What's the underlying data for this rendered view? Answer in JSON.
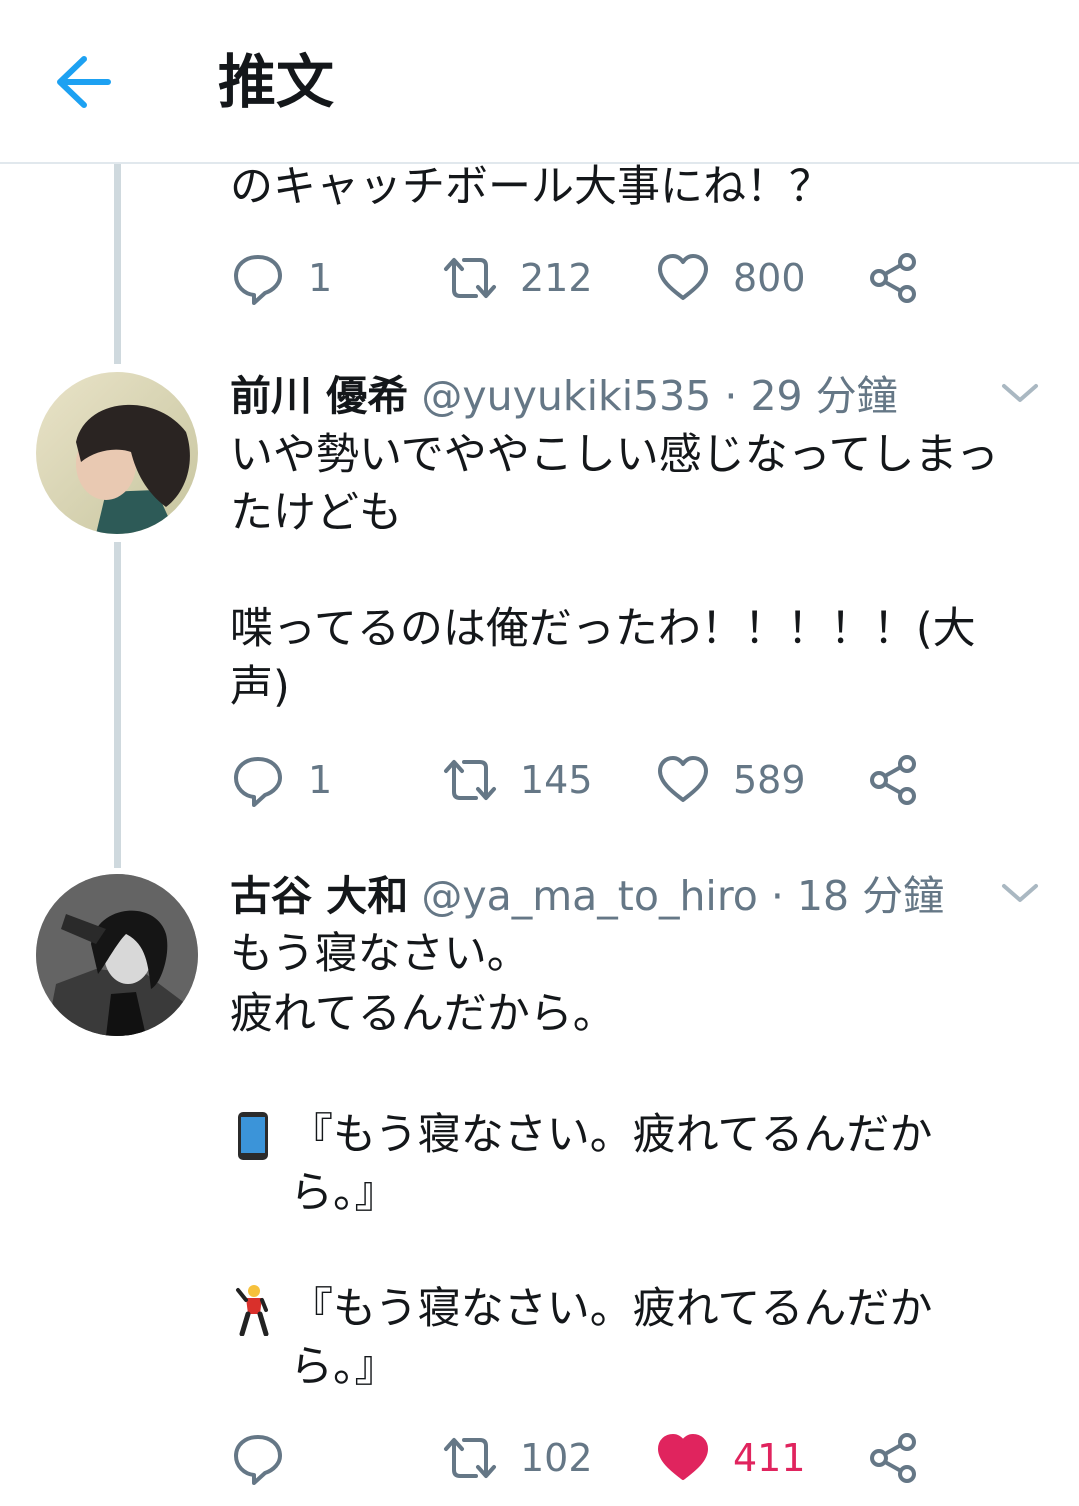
{
  "header": {
    "title": "推文"
  },
  "colors": {
    "accent": "#1da1f2",
    "like_active": "#e0245e",
    "muted": "#657786"
  },
  "tweets": [
    {
      "text": "のキャッチボール大事にね！？",
      "reply_count": "1",
      "retweet_count": "212",
      "like_count": "800",
      "liked": false
    },
    {
      "name": "前川 優希",
      "handle": "@yuyukiki535",
      "time": "· 29 分鐘",
      "text": "いや勢いでややこしい感じなってしまったけども\n\n喋ってるのは俺だったわ！！！！！(大声)",
      "reply_count": "1",
      "retweet_count": "145",
      "like_count": "589",
      "liked": false
    },
    {
      "name": "古谷 大和",
      "handle": "@ya_ma_to_hiro",
      "time": "· 18 分鐘",
      "text_line1": "もう寝なさい。",
      "text_line2": "疲れてるんだから。",
      "quote1_icon": "mobile-phone-emoji",
      "quote1": "『もう寝なさい。疲れてるんだから。』",
      "quote2_icon": "person-emoji",
      "quote2": "『もう寝なさい。疲れてるんだから。』",
      "reply_count": "",
      "retweet_count": "102",
      "like_count": "411",
      "liked": true
    }
  ]
}
